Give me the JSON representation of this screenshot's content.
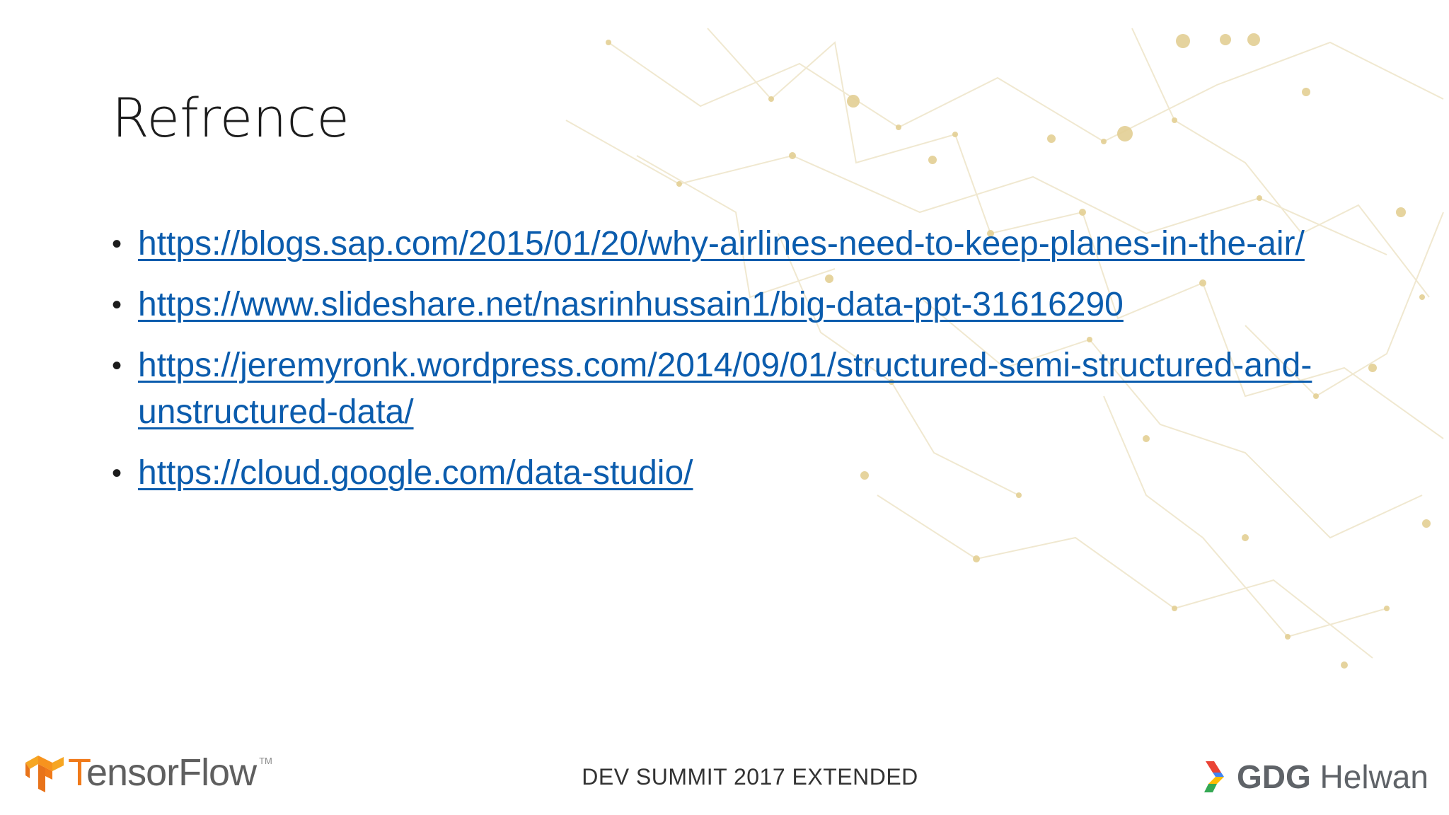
{
  "slide": {
    "title": "Refrence",
    "references": [
      {
        "text": "https://blogs.sap.com/2015/01/20/why-airlines-need-to-keep-planes-in-the-air/"
      },
      {
        "text": "https://www.slideshare.net/nasrinhussain1/big-data-ppt-31616290"
      },
      {
        "text": "https://jeremyronk.wordpress.com/2014/09/01/structured-semi-structured-and-unstructured-data/"
      },
      {
        "text": "https://cloud.google.com/data-studio/"
      }
    ]
  },
  "footer": {
    "left_logo": {
      "icon": "tensorflow-logo-icon",
      "text_first": "T",
      "text_rest": "ensorFlow",
      "trademark": "TM"
    },
    "center_text": "DEV SUMMIT 2017 EXTENDED",
    "right_logo": {
      "icon": "gdg-chevron-icon",
      "bold_text": "GDG",
      "text": " Helwan"
    }
  },
  "colors": {
    "link": "#0b5cad",
    "title": "#1c1c1c",
    "tensorflow_orange": "#f07a1a",
    "network_gold": "#e3cf94"
  }
}
